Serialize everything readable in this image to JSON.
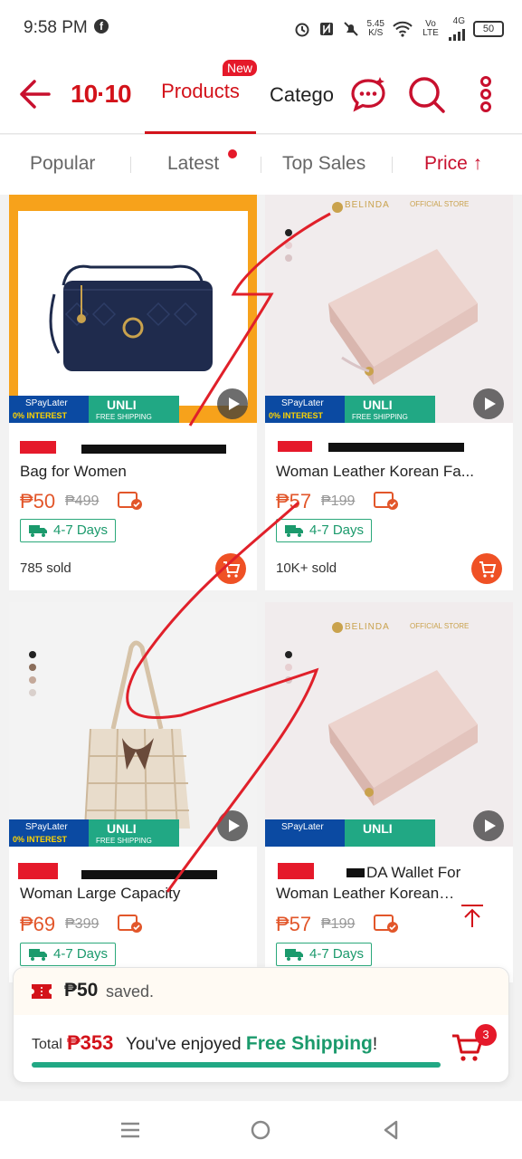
{
  "status_bar": {
    "time": "9:58 PM",
    "speed_value": "5.45",
    "speed_unit": "K/S",
    "network": "Vo LTE",
    "signal": "4G",
    "battery": "50"
  },
  "header": {
    "logo": "10·10",
    "tabs": [
      {
        "label": "Products",
        "badge": "New",
        "active": true
      },
      {
        "label": "Categories",
        "active": false
      }
    ],
    "icons": [
      "back-arrow-icon",
      "chat-icon",
      "search-icon",
      "more-vertical-icon"
    ]
  },
  "sort_options": [
    {
      "label": "Popular",
      "active": false
    },
    {
      "label": "Latest",
      "active": false,
      "dot": true
    },
    {
      "label": "Top Sales",
      "active": false
    },
    {
      "label": "Price ↑",
      "active": true
    }
  ],
  "promo": {
    "spaylater": "SPayLater",
    "interest": "0% INTEREST",
    "unli": "UNLI",
    "free_shipping": "FREE SHIPPING"
  },
  "products": [
    {
      "title": "Bag for Women",
      "price": "₱50",
      "original_price": "₱499",
      "delivery": "4-7 Days",
      "sold": "785 sold"
    },
    {
      "title": "Woman Leather Korean Fa...",
      "price": "₱57",
      "original_price": "₱199",
      "delivery": "4-7 Days",
      "sold": "10K+ sold"
    },
    {
      "title": "Woman Large Capacity",
      "price": "₱69",
      "original_price": "₱399",
      "delivery": "4-7 Days",
      "sold": ""
    },
    {
      "title": "DA Wallet For",
      "title2": "Woman Leather Korean Fa...",
      "price": "₱57",
      "original_price": "₱199",
      "delivery": "4-7 Days",
      "sold": ""
    }
  ],
  "brand_watermark": "BELINDA",
  "brand_store": "OFFICIAL STORE",
  "summary": {
    "saved_amount": "₱50",
    "saved_text": "saved.",
    "total_label": "Total",
    "total_amount": "₱353",
    "enjoy_text": "You've enjoyed",
    "free_shipping_text": "Free Shipping",
    "exclaim": "!",
    "cart_count": "3",
    "progress": 1.0
  },
  "colors": {
    "brand_red": "#d3121a",
    "price_orange": "#e2562a",
    "delivery_green": "#1b9a6c"
  }
}
